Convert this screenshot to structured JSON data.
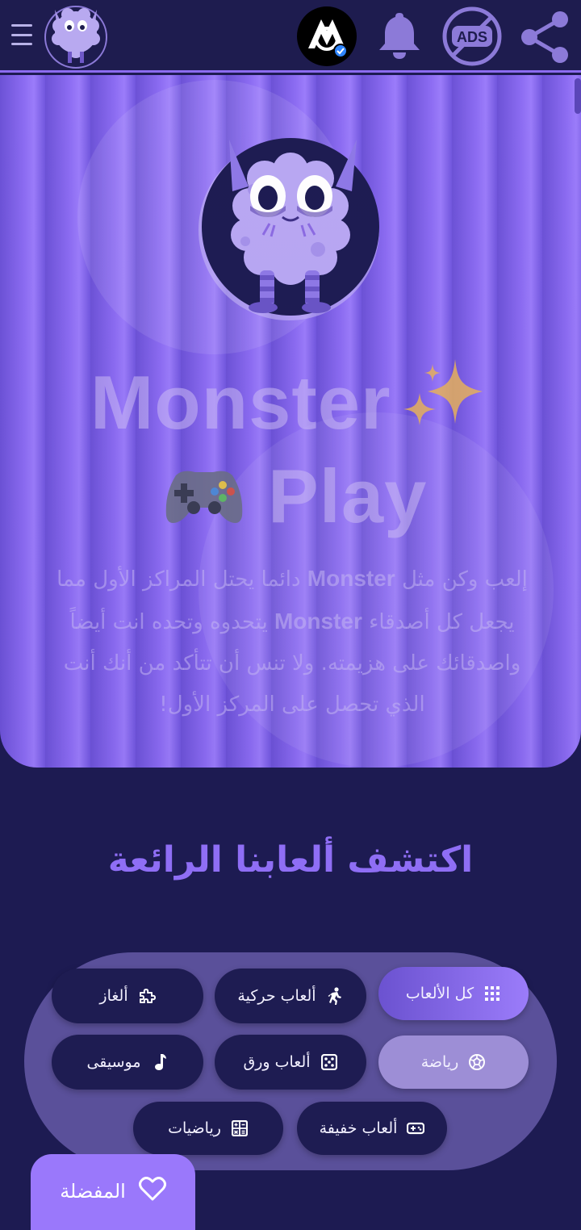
{
  "header": {
    "menu_icon": "hamburger-icon",
    "logo_icon": "monster-logo-icon",
    "badge_icon": "verified-channel-logo-icon",
    "bell_icon": "bell-icon",
    "ads_label": "ADS",
    "share_icon": "share-icon"
  },
  "hero": {
    "title_line1": "Monster",
    "title_line2": "Play",
    "sparkle_emoji": "sparkles-icon",
    "gamepad_emoji": "gamepad-icon",
    "desc_part1": "إلعب وكن مثل ",
    "desc_brand1": "Monster",
    "desc_part2": " دائما يحتل المراكز الأول مما يجعل كل أصدقاء ",
    "desc_brand2": "Monster",
    "desc_part3": " يتحدوه وتحده انت أيضاً واصدقائك على هزيمته. ولا تنس أن تتأكد من أنك أنت الذي تحصل على المركز الأول!"
  },
  "section": {
    "title": "اكتشف ألعابنا الرائعة"
  },
  "categories": [
    {
      "label": "كل الألعاب",
      "icon": "grid-icon"
    },
    {
      "label": "ألعاب حركية",
      "icon": "running-icon"
    },
    {
      "label": "ألغاز",
      "icon": "puzzle-icon"
    },
    {
      "label": "رياضة",
      "icon": "soccer-ball-icon"
    },
    {
      "label": "ألعاب ورق",
      "icon": "dice-icon"
    },
    {
      "label": "موسيقى",
      "icon": "music-note-icon"
    },
    {
      "label": "ألعاب خفيفة",
      "icon": "gamepad-icon"
    },
    {
      "label": "رياضيات",
      "icon": "calculator-icon"
    }
  ],
  "favorites": {
    "label": "المفضلة",
    "icon": "heart-icon"
  },
  "colors": {
    "background": "#1d1b52",
    "accent": "#9a78fb",
    "title": "#8f6ef5",
    "panel": "#5a509a"
  }
}
